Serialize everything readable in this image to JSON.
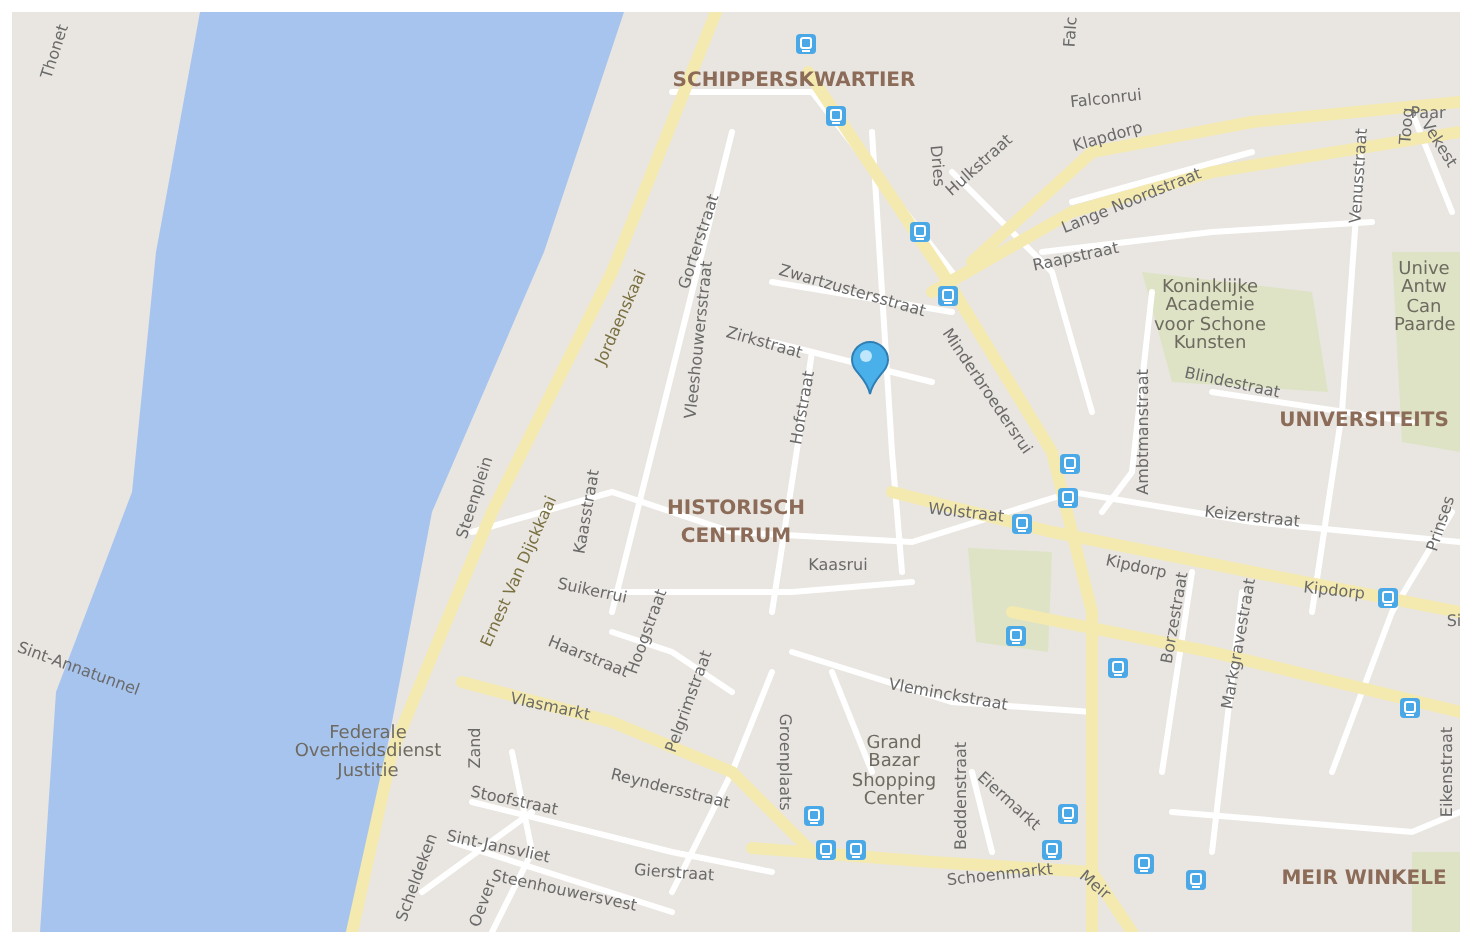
{
  "labels": [
    {
      "kind": "district",
      "text": "SCHIPPERSKWARTIER"
    },
    {
      "kind": "district",
      "text": "HISTORISCH"
    },
    {
      "kind": "district",
      "text": "CENTRUM"
    },
    {
      "kind": "district",
      "text": "UNIVERSITEITS"
    },
    {
      "kind": "district",
      "text": "MEIR WINKELE"
    },
    {
      "kind": "place",
      "text": "Koninklijke Academie voor Schone Kunsten"
    },
    {
      "kind": "place",
      "text": "Unive Antw Can Paarde"
    },
    {
      "kind": "place",
      "text": "Grand Bazar Shopping Center"
    },
    {
      "kind": "place",
      "text": "Federale Overheidsdienst Justitie"
    },
    {
      "kind": "street",
      "text": "Thonet"
    },
    {
      "kind": "street",
      "text": "Gorterstraat"
    },
    {
      "kind": "major",
      "text": "Jordaenskaai"
    },
    {
      "kind": "street",
      "text": "Vleeshouwersstraat"
    },
    {
      "kind": "street",
      "text": "Zwartzustersstraat"
    },
    {
      "kind": "street",
      "text": "Zirkstraat"
    },
    {
      "kind": "street",
      "text": "Hofstraat"
    },
    {
      "kind": "street",
      "text": "Dries"
    },
    {
      "kind": "street",
      "text": "Hulkstraat"
    },
    {
      "kind": "street",
      "text": "Falconrui"
    },
    {
      "kind": "street",
      "text": "Falc"
    },
    {
      "kind": "street",
      "text": "Klapdorp"
    },
    {
      "kind": "street",
      "text": "Lange Noordstraat"
    },
    {
      "kind": "street",
      "text": "Raapstraat"
    },
    {
      "kind": "street",
      "text": "Minderbroedersrui"
    },
    {
      "kind": "street",
      "text": "Ambtmanstraat"
    },
    {
      "kind": "street",
      "text": "Blindestraat"
    },
    {
      "kind": "street",
      "text": "Venusstraat"
    },
    {
      "kind": "street",
      "text": "Toog"
    },
    {
      "kind": "street",
      "text": "Vekest"
    },
    {
      "kind": "street",
      "text": "Paar"
    },
    {
      "kind": "street",
      "text": "Steenplein"
    },
    {
      "kind": "street",
      "text": "Kaasstraat"
    },
    {
      "kind": "major",
      "text": "Ernest Van Dijckkaai"
    },
    {
      "kind": "street",
      "text": "Suikerrui"
    },
    {
      "kind": "street",
      "text": "Haarstraat"
    },
    {
      "kind": "street",
      "text": "Hoogstraat"
    },
    {
      "kind": "street",
      "text": "Pelgrimstraat"
    },
    {
      "kind": "street",
      "text": "Vlasmarkt"
    },
    {
      "kind": "street",
      "text": "Reyndersstraat"
    },
    {
      "kind": "street",
      "text": "Zand"
    },
    {
      "kind": "street",
      "text": "Stoofstraat"
    },
    {
      "kind": "street",
      "text": "Sint-Annatunnel"
    },
    {
      "kind": "street",
      "text": "Sint-Jansvliet"
    },
    {
      "kind": "street",
      "text": "Steenhouwersvest"
    },
    {
      "kind": "street",
      "text": "Gierstraat"
    },
    {
      "kind": "street",
      "text": "Scheldeken"
    },
    {
      "kind": "street",
      "text": "Oever"
    },
    {
      "kind": "street",
      "text": "Wolstraat"
    },
    {
      "kind": "street",
      "text": "Kaasrui"
    },
    {
      "kind": "street",
      "text": "Keizerstraat"
    },
    {
      "kind": "street",
      "text": "Kipdorp"
    },
    {
      "kind": "street",
      "text": "Kipdorp"
    },
    {
      "kind": "street",
      "text": "Prinses"
    },
    {
      "kind": "street",
      "text": "Si"
    },
    {
      "kind": "street",
      "text": "Borzestraat"
    },
    {
      "kind": "street",
      "text": "Markgravestraat"
    },
    {
      "kind": "street",
      "text": "Vleminckstraat"
    },
    {
      "kind": "street",
      "text": "Groenplaats"
    },
    {
      "kind": "street",
      "text": "Beddenstraat"
    },
    {
      "kind": "street",
      "text": "Eiermarkt"
    },
    {
      "kind": "street",
      "text": "Schoenmarkt"
    },
    {
      "kind": "street",
      "text": "Meir"
    },
    {
      "kind": "street",
      "text": "Eikenstraat"
    }
  ]
}
